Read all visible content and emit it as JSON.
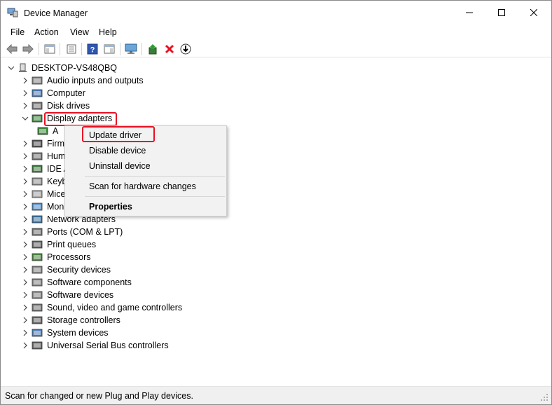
{
  "window": {
    "title": "Device Manager"
  },
  "menu": [
    "File",
    "Action",
    "View",
    "Help"
  ],
  "toolbar": [
    "back-icon",
    "forward-icon",
    "show-hide-console-tree-icon",
    "properties-icon",
    "help-icon",
    "action-pane-icon",
    "monitor-icon",
    "update-driver-icon",
    "uninstall-icon",
    "download-icon"
  ],
  "tree": {
    "root": "DESKTOP-VS48QBQ",
    "items": [
      {
        "label": "Audio inputs and outputs",
        "icon": "speaker-icon",
        "expanded": false
      },
      {
        "label": "Computer",
        "icon": "computer-icon",
        "expanded": false
      },
      {
        "label": "Disk drives",
        "icon": "disk-drive-icon",
        "expanded": false
      },
      {
        "label": "Display adapters",
        "icon": "display-adapter-icon",
        "expanded": true
      },
      {
        "label": "A",
        "icon": "display-adapter-icon",
        "child": true
      },
      {
        "label": "Firm",
        "icon": "firmware-icon",
        "expanded": false
      },
      {
        "label": "Hum",
        "icon": "hid-icon",
        "expanded": false
      },
      {
        "label": "IDE A",
        "icon": "ide-icon",
        "expanded": false
      },
      {
        "label": "Keyb",
        "icon": "keyboard-icon",
        "expanded": false
      },
      {
        "label": "Mice",
        "icon": "mouse-icon",
        "expanded": false
      },
      {
        "label": "Mon",
        "icon": "monitor-icon",
        "expanded": false
      },
      {
        "label": "Network adapters",
        "icon": "network-adapter-icon",
        "expanded": false
      },
      {
        "label": "Ports (COM & LPT)",
        "icon": "port-icon",
        "expanded": false
      },
      {
        "label": "Print queues",
        "icon": "printer-icon",
        "expanded": false
      },
      {
        "label": "Processors",
        "icon": "processor-icon",
        "expanded": false
      },
      {
        "label": "Security devices",
        "icon": "security-device-icon",
        "expanded": false
      },
      {
        "label": "Software components",
        "icon": "software-component-icon",
        "expanded": false
      },
      {
        "label": "Software devices",
        "icon": "software-device-icon",
        "expanded": false
      },
      {
        "label": "Sound, video and game controllers",
        "icon": "sound-icon",
        "expanded": false
      },
      {
        "label": "Storage controllers",
        "icon": "storage-controller-icon",
        "expanded": false
      },
      {
        "label": "System devices",
        "icon": "system-device-icon",
        "expanded": false
      },
      {
        "label": "Universal Serial Bus controllers",
        "icon": "usb-icon",
        "expanded": false
      }
    ]
  },
  "context_menu": {
    "items": [
      "Update driver",
      "Disable device",
      "Uninstall device",
      "Scan for hardware changes",
      "Properties"
    ]
  },
  "statusbar": {
    "text": "Scan for changed or new Plug and Play devices."
  },
  "colors": {
    "highlight_box": "#e81123",
    "menu_bg": "#f2f2f2"
  }
}
